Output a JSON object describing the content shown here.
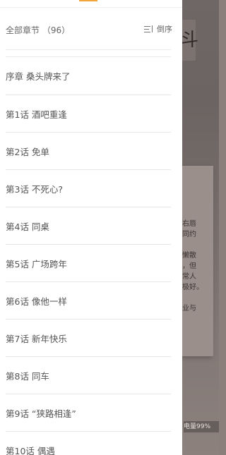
{
  "toc": {
    "header_title": "全部章节 （96）",
    "sort_label": "倒序"
  },
  "chapters": [
    "序章 桑头牌来了",
    "第1话 酒吧重逢",
    "第2话 免单",
    "第3话 不死心?",
    "第4话 同桌",
    "第5话 广场跨年",
    "第6话 像他一样",
    "第7话 新年快乐",
    "第8话 同车",
    "第9话 “狭路相逢”",
    "第10话 偶遇"
  ],
  "background": {
    "box_char": "斗",
    "text_lines": [
      "右唇",
      "同约",
      "",
      "懒散",
      "，但",
      "常人",
      "极好。",
      "",
      "业与"
    ],
    "battery": "电量99%"
  }
}
